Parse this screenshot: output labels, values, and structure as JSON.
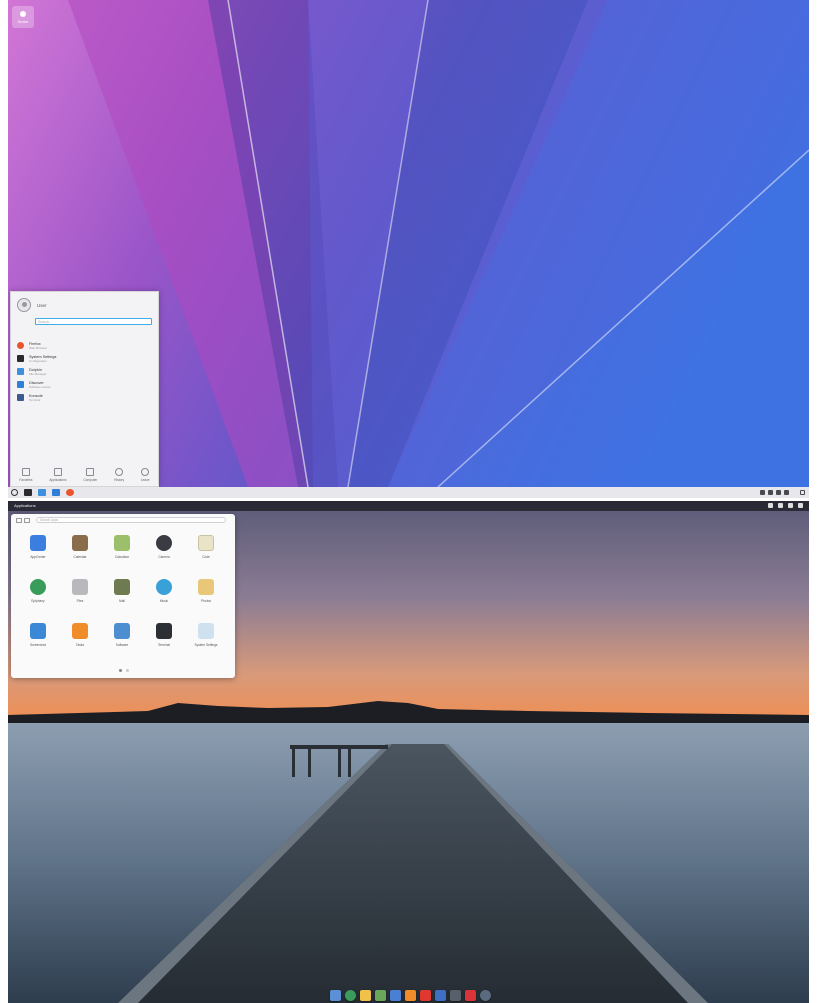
{
  "kde": {
    "desktop_icon": {
      "label": "Home",
      "icon": "home-folder-icon"
    },
    "kickoff": {
      "user_name": "User",
      "search_placeholder": "Search...",
      "section_label": "",
      "favorites": [
        {
          "name": "Firefox",
          "description": "Web Browser",
          "icon": "firefox-icon",
          "color": "#e8552d"
        },
        {
          "name": "System Settings",
          "description": "Configuration",
          "icon": "settings-icon",
          "color": "#2b2b2f"
        },
        {
          "name": "Dolphin",
          "description": "File Manager",
          "icon": "folder-icon",
          "color": "#3d8fe0"
        },
        {
          "name": "Discover",
          "description": "Software Center",
          "icon": "discover-icon",
          "color": "#2f7fd8"
        },
        {
          "name": "Konsole",
          "description": "Terminal",
          "icon": "terminal-icon",
          "color": "#3b5a8e"
        }
      ],
      "tabs": [
        {
          "label": "Favorites",
          "icon": "star-icon"
        },
        {
          "label": "Applications",
          "icon": "grid-icon"
        },
        {
          "label": "Computer",
          "icon": "computer-icon"
        },
        {
          "label": "History",
          "icon": "history-icon"
        },
        {
          "label": "Leave",
          "icon": "power-icon"
        }
      ]
    },
    "panel": {
      "tasks": [
        {
          "icon": "terminal-icon",
          "color": "#2b2b2f"
        },
        {
          "icon": "folder-icon",
          "color": "#3d8fe0"
        },
        {
          "icon": "discover-icon",
          "color": "#2f7fd8"
        },
        {
          "icon": "firefox-icon",
          "color": "#e8552d"
        }
      ],
      "clock_time": "",
      "clock_date": ""
    }
  },
  "eos": {
    "topbar": {
      "apps_label": "Applications",
      "date": ""
    },
    "slingshot": {
      "search_placeholder": "Search Apps",
      "apps": [
        {
          "label": "AppCenter",
          "icon": "appcenter-icon",
          "color": "#3b7ee0"
        },
        {
          "label": "Calendar",
          "icon": "calendar-icon",
          "color": "#8a6d4b"
        },
        {
          "label": "Calculator",
          "icon": "calculator-icon",
          "color": "#9bbf6a"
        },
        {
          "label": "Camera",
          "icon": "camera-icon",
          "color": "#3b3b44"
        },
        {
          "label": "Code",
          "icon": "code-icon",
          "color": "#e9e4c8"
        },
        {
          "label": "Epiphany",
          "icon": "browser-icon",
          "color": "#3a9c5a"
        },
        {
          "label": "Files",
          "icon": "files-icon",
          "color": "#b9b9bd"
        },
        {
          "label": "Mail",
          "icon": "mail-icon",
          "color": "#6e7a4f"
        },
        {
          "label": "Music",
          "icon": "music-icon",
          "color": "#3aa0d8"
        },
        {
          "label": "Photos",
          "icon": "photos-icon",
          "color": "#e8c878"
        },
        {
          "label": "Screenshot",
          "icon": "screenshot-icon",
          "color": "#3a88d6"
        },
        {
          "label": "Tasks",
          "icon": "tasks-icon",
          "color": "#f08c2a"
        },
        {
          "label": "Software",
          "icon": "software-icon",
          "color": "#4c8ed0"
        },
        {
          "label": "Terminal",
          "icon": "terminal-icon",
          "color": "#2c2f34"
        },
        {
          "label": "System Settings",
          "icon": "settings-icon",
          "color": "#cfe0ef"
        }
      ]
    },
    "dock": [
      {
        "icon": "mail-icon",
        "color": "#5b8fd6"
      },
      {
        "icon": "browser-icon",
        "color": "#3a9c5a"
      },
      {
        "icon": "music-icon",
        "color": "#f2c14a"
      },
      {
        "icon": "photos-icon",
        "color": "#6aa75a"
      },
      {
        "icon": "calendar-icon",
        "color": "#4a7fd6"
      },
      {
        "icon": "tasks-icon",
        "color": "#f08c2a"
      },
      {
        "icon": "videos-icon",
        "color": "#e0382f"
      },
      {
        "icon": "files-icon",
        "color": "#3f6fc4"
      },
      {
        "icon": "terminal-icon",
        "color": "#55606a"
      },
      {
        "icon": "appcenter-icon",
        "color": "#d8343a"
      },
      {
        "icon": "settings-icon",
        "color": "#5a6b80"
      }
    ]
  }
}
